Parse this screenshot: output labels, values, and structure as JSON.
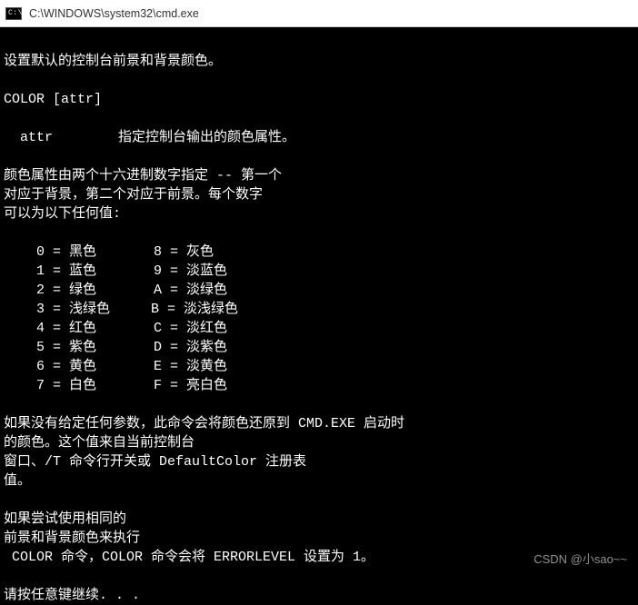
{
  "titlebar": {
    "icon_label": "C:\\.",
    "title": "C:\\WINDOWS\\system32\\cmd.exe"
  },
  "terminal": {
    "lines": [
      "设置默认的控制台前景和背景颜色。",
      "",
      "COLOR [attr]",
      "",
      "  attr        指定控制台输出的颜色属性。",
      "",
      "颜色属性由两个十六进制数字指定 -- 第一个",
      "对应于背景，第二个对应于前景。每个数字",
      "可以为以下任何值:",
      "",
      "    0 = 黑色       8 = 灰色",
      "    1 = 蓝色       9 = 淡蓝色",
      "    2 = 绿色       A = 淡绿色",
      "    3 = 浅绿色     B = 淡浅绿色",
      "    4 = 红色       C = 淡红色",
      "    5 = 紫色       D = 淡紫色",
      "    6 = 黄色       E = 淡黄色",
      "    7 = 白色       F = 亮白色",
      "",
      "如果没有给定任何参数，此命令会将颜色还原到 CMD.EXE 启动时",
      "的颜色。这个值来自当前控制台",
      "窗口、/T 命令行开关或 DefaultColor 注册表",
      "值。",
      "",
      "如果尝试使用相同的",
      "前景和背景颜色来执行",
      " COLOR 命令，COLOR 命令会将 ERRORLEVEL 设置为 1。",
      "",
      "请按任意键继续. . ."
    ]
  },
  "watermark": {
    "text": "CSDN @小sao~~"
  }
}
